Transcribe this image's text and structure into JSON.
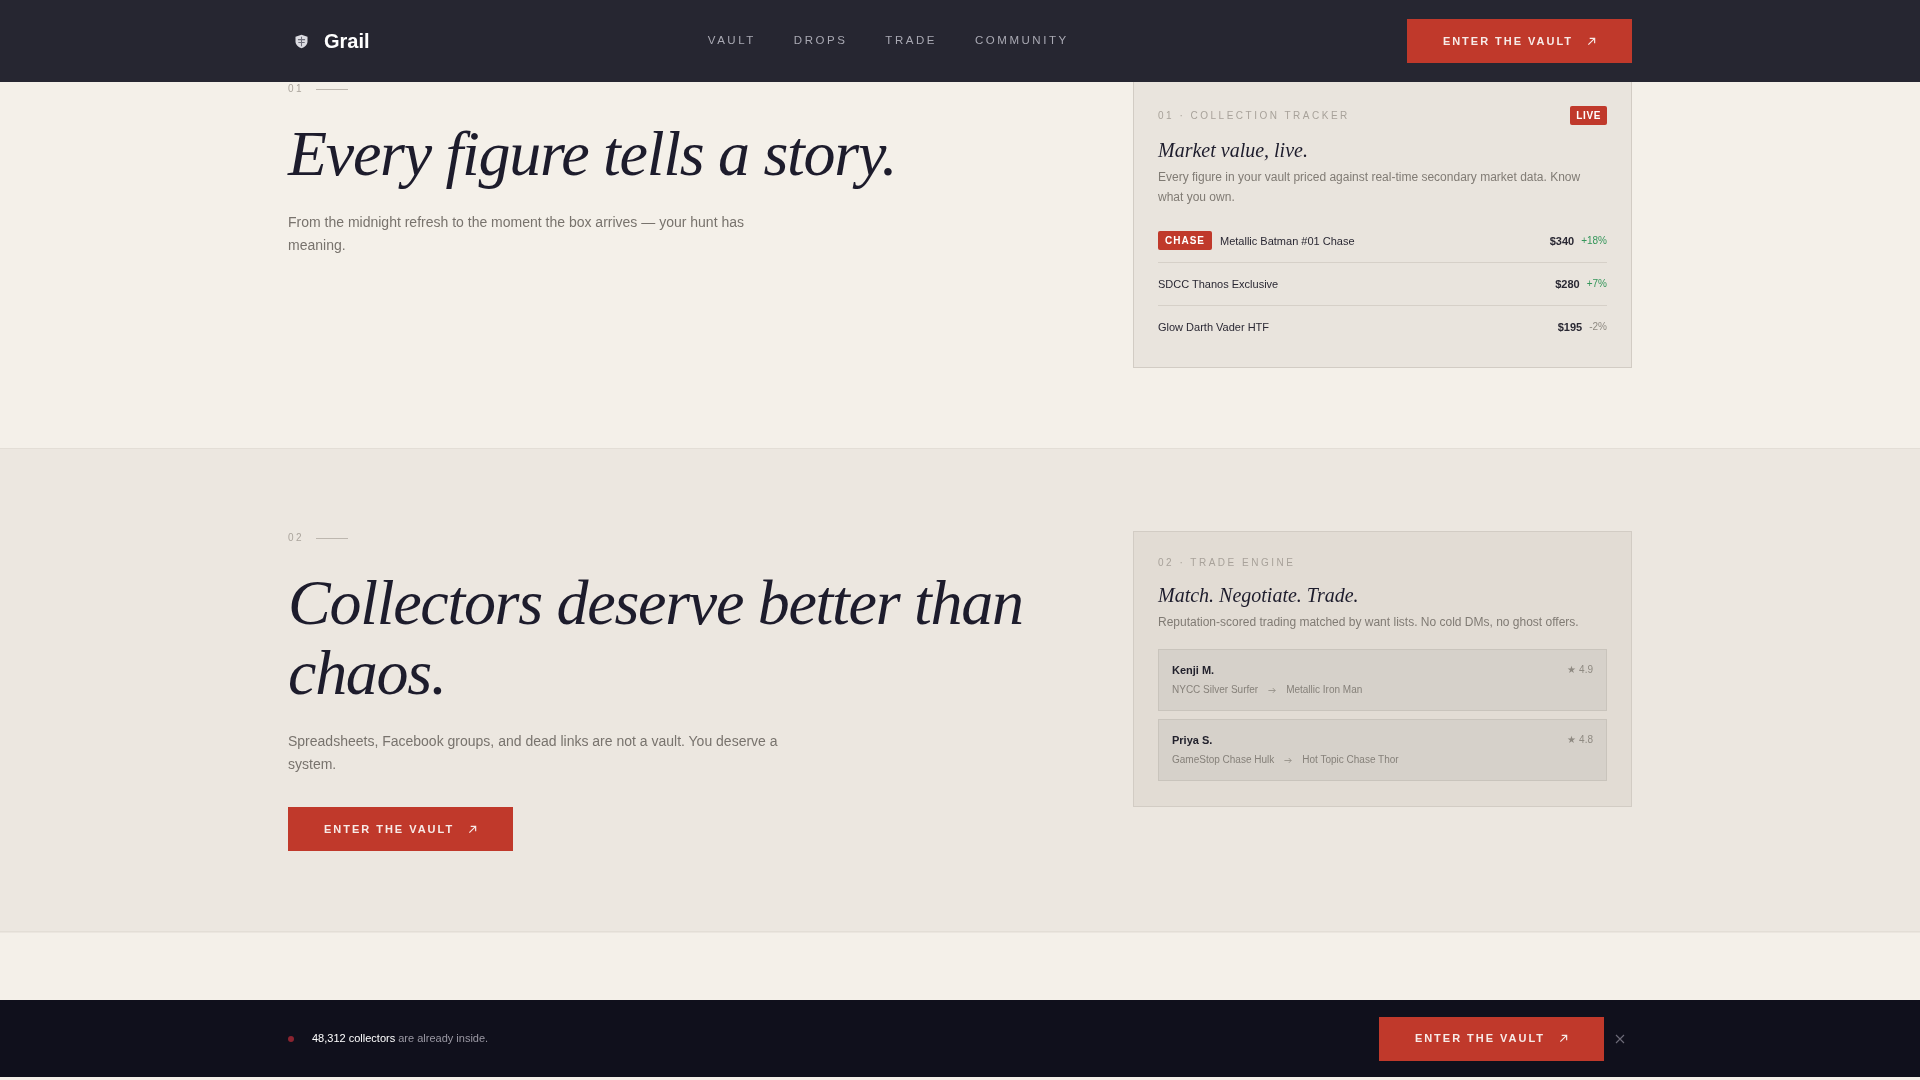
{
  "nav": {
    "logo": "Grail",
    "links": [
      "VAULT",
      "DROPS",
      "TRADE",
      "COMMUNITY"
    ],
    "cta": "ENTER THE VAULT"
  },
  "sections": [
    {
      "number": "01",
      "headline": "Every figure tells a story.",
      "text": "From the midnight refresh to the moment the box arrives — your hunt has meaning.",
      "card": {
        "kind": "tracker",
        "label": "01 · COLLECTION TRACKER",
        "badge": "LIVE",
        "title": "Market value, live.",
        "text": "Every figure in your vault priced against real-time secondary market data. Know what you own.",
        "items": [
          {
            "tag": "CHASE",
            "name": "Metallic Batman #01 Chase",
            "price": "$340",
            "change": "+18%",
            "rising": true
          },
          {
            "name": "SDCC Thanos Exclusive",
            "price": "$280",
            "change": "+7%",
            "rising": true
          },
          {
            "name": "Glow Darth Vader HTF",
            "price": "$195",
            "change": "-2%",
            "rising": false
          }
        ]
      }
    },
    {
      "number": "02",
      "headline": "Collectors deserve better than chaos.",
      "text": "Spreadsheets, Facebook groups, and dead links are not a vault. You deserve a system.",
      "button": "ENTER THE VAULT",
      "card": {
        "kind": "trade",
        "label": "02 · TRADE ENGINE",
        "title": "Match. Negotiate. Trade.",
        "text": "Reputation-scored trading matched by want lists. No cold DMs, no ghost offers.",
        "matches": [
          {
            "name": "Kenji M.",
            "rating": "★ 4.9",
            "offer": "NYCC Silver Surfer",
            "want": "Metallic Iron Man"
          },
          {
            "name": "Priya S.",
            "rating": "★ 4.8",
            "offer": "GameStop Chase Hulk",
            "want": "Hot Topic Chase Thor"
          }
        ]
      }
    }
  ],
  "banner": {
    "text": "**48,312 collectors** are already inside.",
    "button": "ENTER THE VAULT"
  }
}
